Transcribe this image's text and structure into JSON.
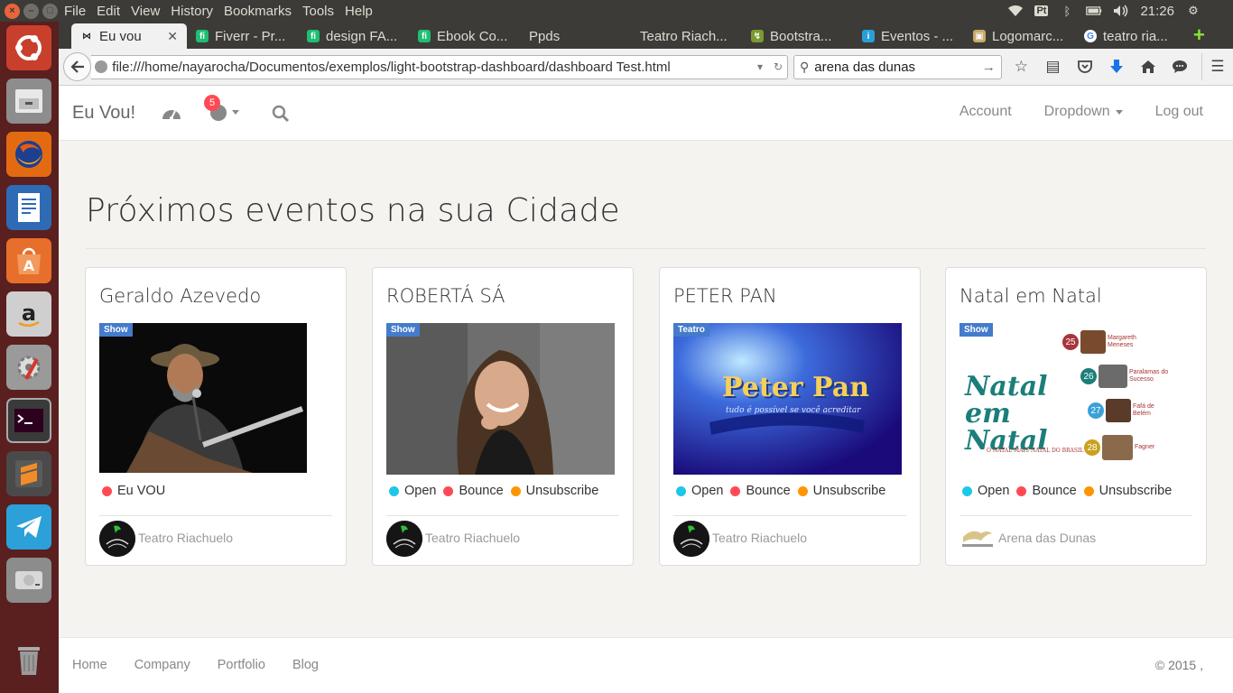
{
  "menubar": {
    "items": [
      "File",
      "Edit",
      "View",
      "History",
      "Bookmarks",
      "Tools",
      "Help"
    ]
  },
  "panel": {
    "keyboard": "Pt",
    "clock": "21:26"
  },
  "tabs": [
    {
      "label": "Eu vou",
      "favicon": "bow-tie-icon",
      "active": true
    },
    {
      "label": "Fiverr - Pr...",
      "favicon": "fiverr-icon"
    },
    {
      "label": "design FA...",
      "favicon": "fiverr-icon"
    },
    {
      "label": "Ebook Co...",
      "favicon": "fiverr-icon"
    },
    {
      "label": "Ppds",
      "favicon": "none"
    },
    {
      "label": "Teatro Riach...",
      "favicon": "none"
    },
    {
      "label": "Bootstra...",
      "favicon": "bootstrap-icon"
    },
    {
      "label": "Eventos - ...",
      "favicon": "info-icon"
    },
    {
      "label": "Logomarc...",
      "favicon": "image-icon"
    },
    {
      "label": "teatro ria...",
      "favicon": "google-icon"
    }
  ],
  "address": {
    "url": "file:///home/nayarocha/Documentos/exemplos/light-bootstrap-dashboard/dashboard Test.html",
    "search": "arena das dunas"
  },
  "app": {
    "brand": "Eu Vou!",
    "notification_count": "5",
    "nav_right": {
      "account": "Account",
      "dropdown": "Dropdown",
      "logout": "Log out"
    }
  },
  "page": {
    "title": "Próximos eventos na sua Cidade"
  },
  "cards": [
    {
      "title": "Geraldo Azevedo",
      "badge": "Show",
      "legend": [
        {
          "label": "Eu VOU",
          "color": "#ff4a55"
        }
      ],
      "venue": "Teatro Riachuelo"
    },
    {
      "title": "ROBERTÁ SÁ",
      "badge": "Show",
      "legend": [
        {
          "label": "Open",
          "color": "#1dc7ea"
        },
        {
          "label": "Bounce",
          "color": "#ff4a55"
        },
        {
          "label": "Unsubscribe",
          "color": "#ff9500"
        }
      ],
      "venue": "Teatro Riachuelo"
    },
    {
      "title": "PETER PAN",
      "badge": "Teatro",
      "image_text": "Peter Pan",
      "image_subtext": "tudo é possível se você acreditar",
      "legend": [
        {
          "label": "Open",
          "color": "#1dc7ea"
        },
        {
          "label": "Bounce",
          "color": "#ff4a55"
        },
        {
          "label": "Unsubscribe",
          "color": "#ff9500"
        }
      ],
      "venue": "Teatro Riachuelo"
    },
    {
      "title": "Natal em Natal",
      "badge": "Show",
      "image_text": "Natal em Natal",
      "image_subtext": "O NATAL MAIS NATAL DO BRASIL",
      "image_schedule": [
        {
          "day": "25",
          "name": "Margareth Meneses"
        },
        {
          "day": "26",
          "name": "Paralamas do Sucesso"
        },
        {
          "day": "27",
          "name": "Fafá de Belém"
        },
        {
          "day": "28",
          "name": "Fagner"
        }
      ],
      "legend": [
        {
          "label": "Open",
          "color": "#1dc7ea"
        },
        {
          "label": "Bounce",
          "color": "#ff4a55"
        },
        {
          "label": "Unsubscribe",
          "color": "#ff9500"
        }
      ],
      "venue": "Arena das Dunas"
    }
  ],
  "footer": {
    "links": [
      "Home",
      "Company",
      "Portfolio",
      "Blog"
    ],
    "copyright": "© 2015 ,"
  }
}
